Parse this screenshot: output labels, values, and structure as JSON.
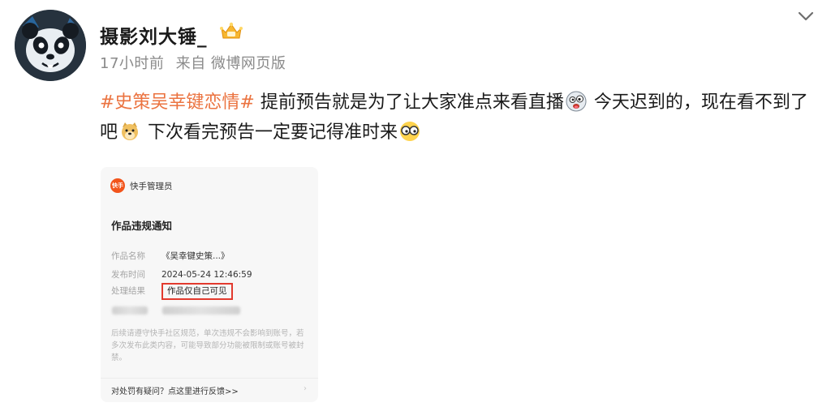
{
  "post": {
    "username": "摄影刘大锤_",
    "time": "17小时前",
    "source": "来自 微博网页版",
    "hashtag": "#史策吴幸键恋情#",
    "text_part1": " 提前预告就是为了让大家准点来看直播",
    "text_part2": " 今天迟到的，现在看不到了吧",
    "text_part3": " 下次看完预告一定要记得准时来"
  },
  "icons": {
    "avatar": "panda-avatar",
    "badge": "vip-crown-badge",
    "menu": "chevron-down-icon",
    "emoji1": "crazy-face-emoji",
    "emoji2": "doge-emoji",
    "emoji3": "glasses-emoji"
  },
  "card": {
    "app_logo_text": "快手",
    "sender": "快手管理员",
    "title": "作品违规通知",
    "rows": [
      {
        "key": "作品名称",
        "value": "《吴幸键史策...》"
      },
      {
        "key": "发布时间",
        "value": "2024-05-24 12:46:59"
      },
      {
        "key": "处理结果",
        "value": "作品仅自己可见"
      }
    ],
    "notice": "后续请遵守快手社区规范，单次违规不会影响到账号，若多次发布此类内容，可能导致部分功能被限制或账号被封禁。",
    "feedback": "对处罚有疑问？点这里进行反馈>>",
    "feedback_arrow": "›"
  },
  "colors": {
    "hashtag": "#eb7340",
    "highlight_border": "#e23a2e",
    "kuaishou_brand": "#f2541b"
  }
}
